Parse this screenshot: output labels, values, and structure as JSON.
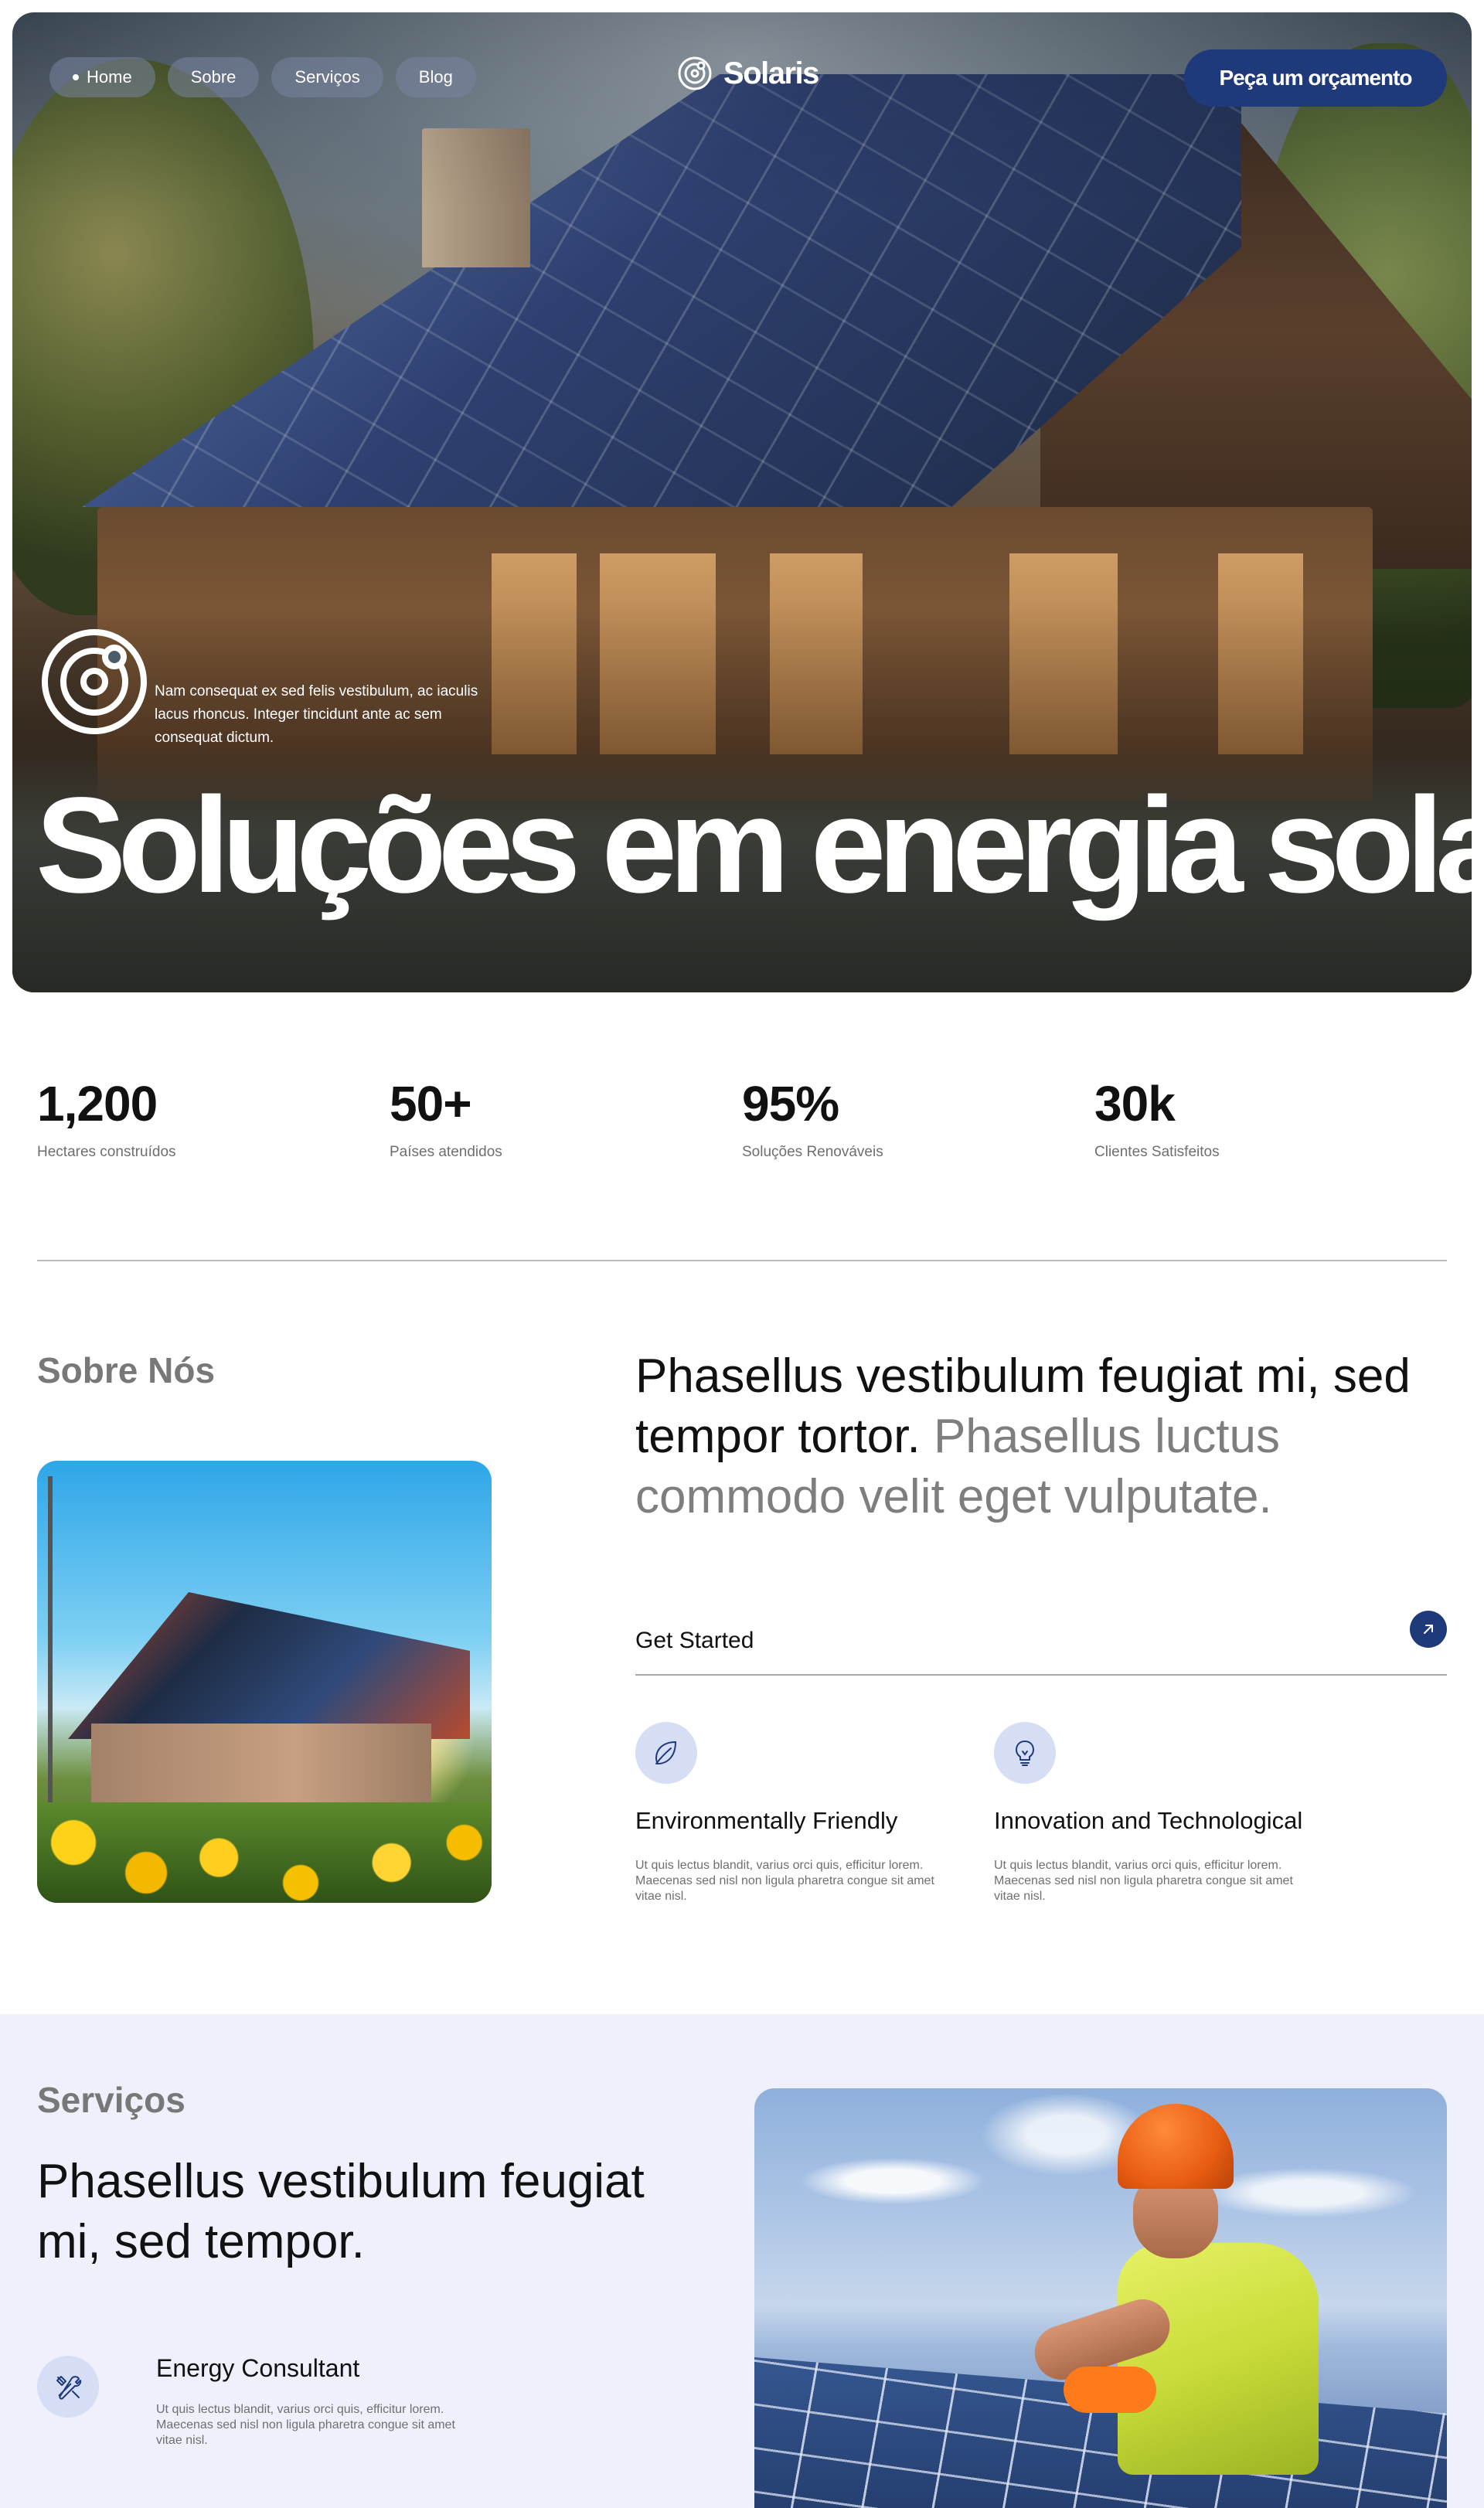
{
  "nav": {
    "items": [
      {
        "label": "Home",
        "active": true
      },
      {
        "label": "Sobre",
        "active": false
      },
      {
        "label": "Serviços",
        "active": false
      },
      {
        "label": "Blog",
        "active": false
      }
    ],
    "brand": "Solaris",
    "cta": "Peça um orçamento"
  },
  "hero": {
    "intro": "Nam consequat ex sed felis vestibulum, ac iaculis lacus rhoncus. Integer tincidunt ante ac sem consequat dictum.",
    "title": "Soluções em energia solar"
  },
  "stats": [
    {
      "value": "1,200",
      "label": "Hectares construídos"
    },
    {
      "value": "50+",
      "label": "Países atendidos"
    },
    {
      "value": "95%",
      "label": "Soluções Renováveis"
    },
    {
      "value": "30k",
      "label": "Clientes Satisfeitos"
    }
  ],
  "about": {
    "heading": "Sobre Nós",
    "lead_dark": "Phasellus vestibulum feugiat mi, sed tempor tortor.",
    "lead_muted": "Phasellus luctus commodo velit eget vulputate.",
    "get_started": "Get Started",
    "features": [
      {
        "icon": "leaf-icon",
        "title": "Environmentally Friendly",
        "desc": "Ut quis lectus blandit, varius orci quis, efficitur lorem. Maecenas sed nisl non ligula pharetra congue sit amet vitae nisl."
      },
      {
        "icon": "lightbulb-icon",
        "title": "Innovation and Technological",
        "desc": "Ut quis lectus blandit, varius orci quis, efficitur lorem. Maecenas sed nisl non ligula pharetra congue sit amet vitae nisl."
      }
    ]
  },
  "services": {
    "heading": "Serviços",
    "lead": "Phasellus vestibulum feugiat mi, sed tempor.",
    "items": [
      {
        "icon": "tools-icon",
        "title": "Energy Consultant",
        "desc": "Ut quis lectus blandit, varius orci quis, efficitur lorem. Maecenas sed nisl non ligula pharetra congue sit amet vitae nisl."
      }
    ]
  },
  "colors": {
    "primary": "#1f3a7a",
    "icon_bg": "#d6def5",
    "services_bg": "#eef1fb",
    "muted_text": "#7e7e7e"
  }
}
